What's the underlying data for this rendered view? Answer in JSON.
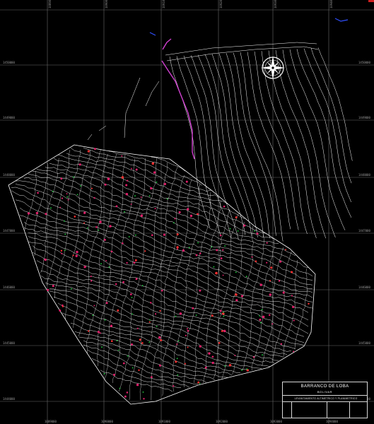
{
  "drawing": {
    "grid_labels_top": [
      "1089000",
      "1090000",
      "1091000",
      "1092000",
      "1093000",
      "1094000"
    ],
    "grid_labels_left": [
      "1450000",
      "1449000",
      "1448000",
      "1447000",
      "1446000",
      "1445000",
      "1444000"
    ],
    "grid_labels_bottom": [
      "1089000",
      "1090000",
      "1091000",
      "1092000",
      "1093000",
      "1094000"
    ],
    "grid_labels_right": [
      "1450000",
      "1449000",
      "1448000",
      "1447000",
      "1446000",
      "1445000",
      "1444000"
    ]
  },
  "title_block": {
    "title": "BARRANCO DE LOBA",
    "subtitle": "BOLIVAR",
    "description": "LEVANTAMIENTO ALTIMETRICO Y PLANIMETRICO"
  },
  "icons": {
    "north_arrow": "compass-rose-icon"
  },
  "colors": {
    "background": "#000000",
    "contours": "#ffffff",
    "points": "#e0206a",
    "road": "#d040d0",
    "vegetation": "#20d040",
    "water": "#3050ff"
  }
}
